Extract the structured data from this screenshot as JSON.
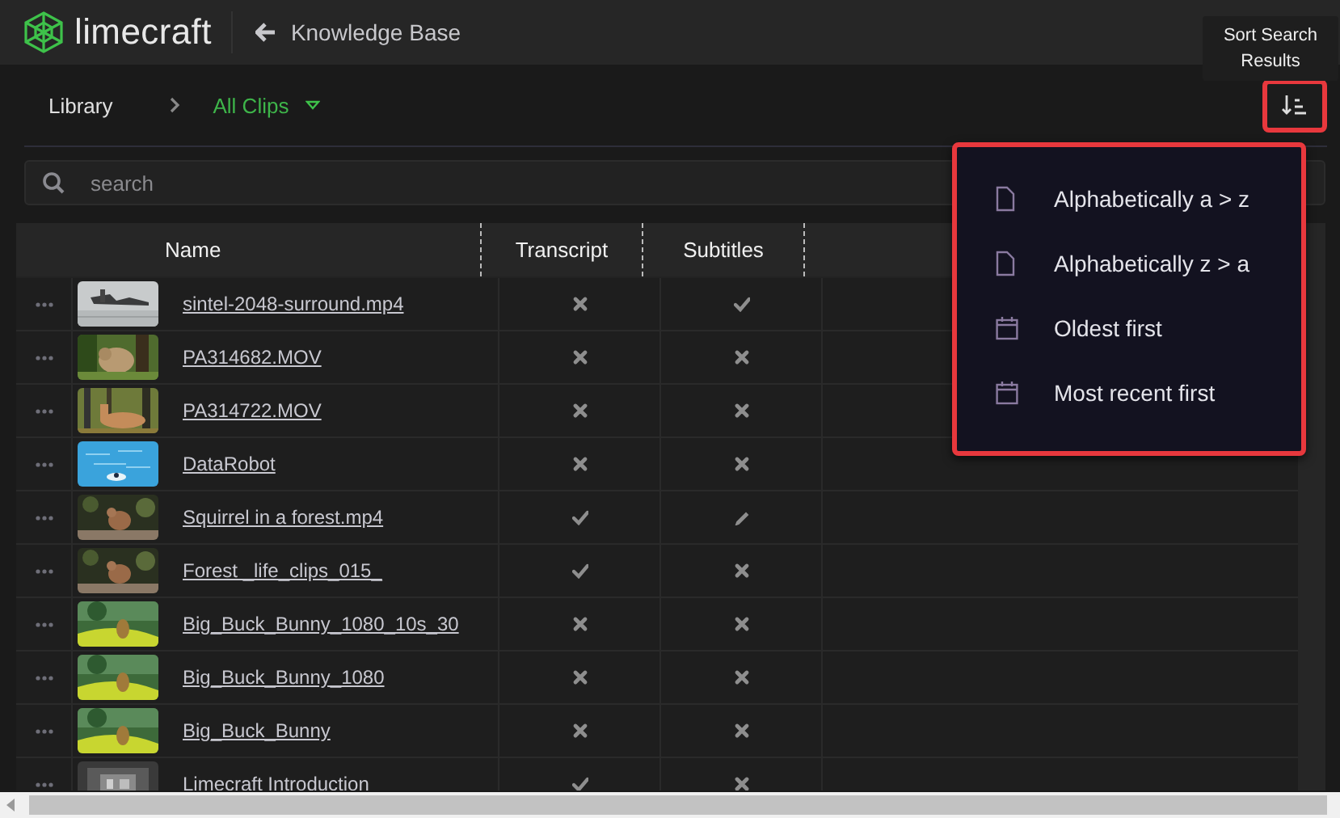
{
  "header": {
    "logo": "limecraft",
    "back_label": "Knowledge Base"
  },
  "tooltip": "Sort Search Results",
  "breadcrumb": {
    "root": "Library",
    "current": "All Clips"
  },
  "sort_button": {
    "highlighted": true
  },
  "search": {
    "placeholder": "search"
  },
  "table": {
    "columns": [
      "Name",
      "Transcript",
      "Subtitles"
    ],
    "rows": [
      {
        "name": "sintel-2048-surround.mp4",
        "transcript": {
          "kind": "cross"
        },
        "subtitles": {
          "kind": "check"
        }
      },
      {
        "name": "PA314682.MOV",
        "transcript": {
          "kind": "cross"
        },
        "subtitles": {
          "kind": "cross"
        }
      },
      {
        "name": "PA314722.MOV",
        "transcript": {
          "kind": "cross"
        },
        "subtitles": {
          "kind": "cross"
        }
      },
      {
        "name": "DataRobot",
        "transcript": {
          "kind": "cross"
        },
        "subtitles": {
          "kind": "cross"
        }
      },
      {
        "name": "Squirrel in a forest.mp4",
        "transcript": {
          "kind": "check"
        },
        "subtitles": {
          "kind": "pencil"
        }
      },
      {
        "name": "Forest _life_clips_015_",
        "transcript": {
          "kind": "check"
        },
        "subtitles": {
          "kind": "cross"
        }
      },
      {
        "name": "Big_Buck_Bunny_1080_10s_30",
        "transcript": {
          "kind": "cross"
        },
        "subtitles": {
          "kind": "cross"
        }
      },
      {
        "name": "Big_Buck_Bunny_1080",
        "transcript": {
          "kind": "cross"
        },
        "subtitles": {
          "kind": "cross"
        }
      },
      {
        "name": "Big_Buck_Bunny",
        "transcript": {
          "kind": "cross"
        },
        "subtitles": {
          "kind": "cross"
        }
      },
      {
        "name": "Limecraft Introduction",
        "transcript": {
          "kind": "check"
        },
        "subtitles": {
          "kind": "cross"
        }
      }
    ]
  },
  "sort_menu": {
    "highlighted": true,
    "items": [
      {
        "kind": "file",
        "label": "Alphabetically a > z"
      },
      {
        "kind": "file",
        "label": "Alphabetically z > a"
      },
      {
        "kind": "date",
        "label": "Oldest first"
      },
      {
        "kind": "date",
        "label": "Most recent first"
      }
    ]
  }
}
